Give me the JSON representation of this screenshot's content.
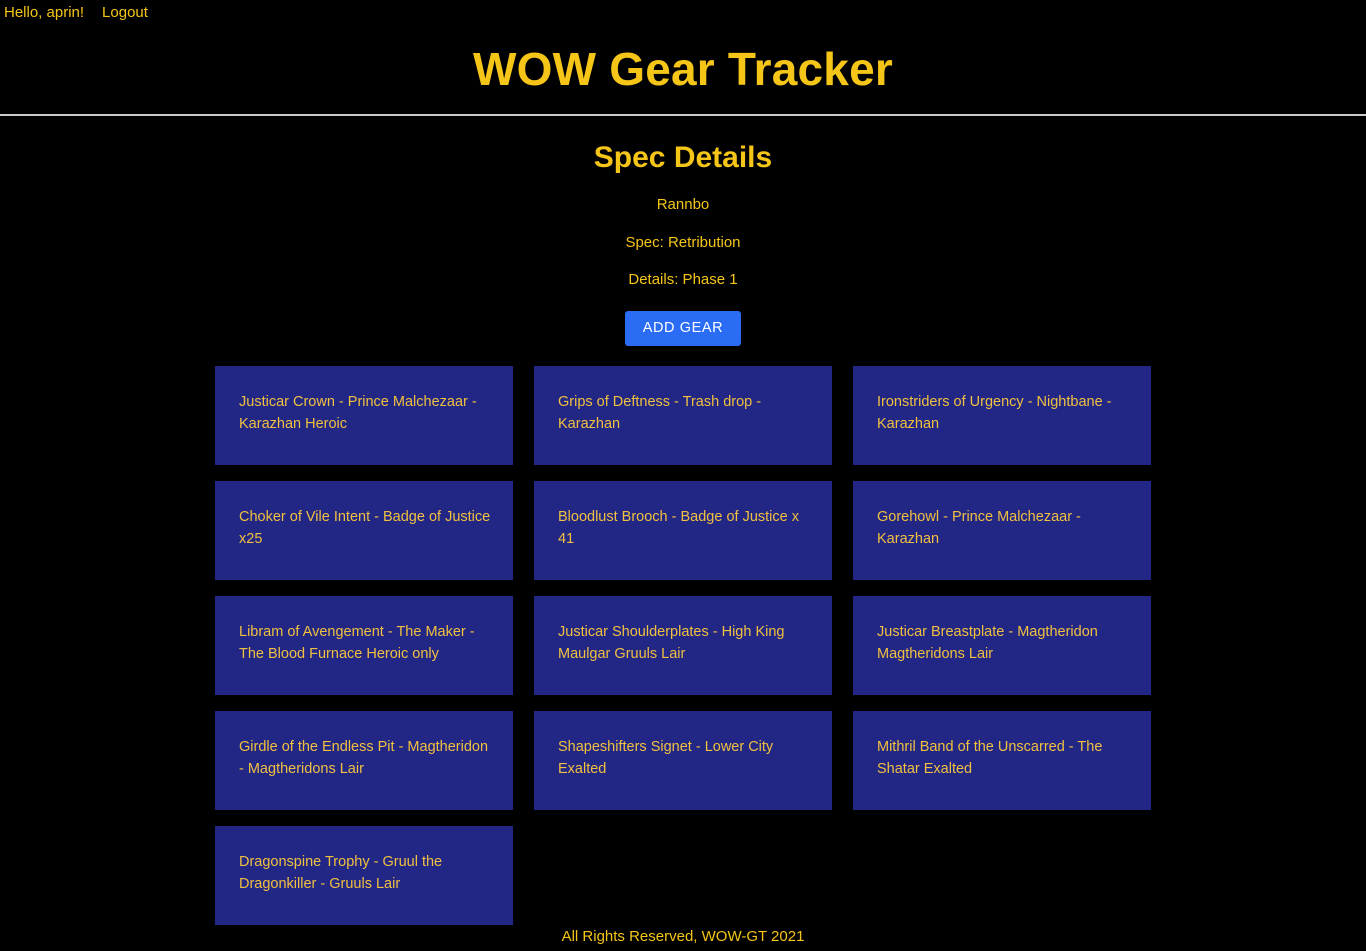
{
  "auth": {
    "greeting": "Hello, aprin!",
    "logout_label": "Logout"
  },
  "site": {
    "title": "WOW Gear Tracker"
  },
  "spec": {
    "heading": "Spec Details",
    "character": "Rannbo",
    "spec_line": "Spec: Retribution",
    "details_line": "Details: Phase 1",
    "add_gear_label": "ADD GEAR"
  },
  "colors": {
    "background": "#000000",
    "gold": "#f5c518",
    "card_navy": "#222685",
    "button_blue": "#2a6cf4",
    "divider": "#c9c9c9"
  },
  "gear": [
    {
      "label": "Justicar Crown - Prince Malchezaar - Karazhan Heroic"
    },
    {
      "label": "Grips of Deftness - Trash drop - Karazhan"
    },
    {
      "label": "Ironstriders of Urgency - Nightbane - Karazhan"
    },
    {
      "label": "Choker of Vile Intent - Badge of Justice x25"
    },
    {
      "label": "Bloodlust Brooch - Badge of Justice x 41"
    },
    {
      "label": "Gorehowl - Prince Malchezaar - Karazhan"
    },
    {
      "label": "Libram of Avengement - The Maker - The Blood Furnace Heroic only"
    },
    {
      "label": "Justicar Shoulderplates - High King Maulgar Gruuls Lair"
    },
    {
      "label": "Justicar Breastplate - Magtheridon Magtheridons Lair"
    },
    {
      "label": "Girdle of the Endless Pit - Magtheridon - Magtheridons Lair"
    },
    {
      "label": "Shapeshifters Signet - Lower City Exalted"
    },
    {
      "label": "Mithril Band of the Unscarred - The Shatar Exalted"
    },
    {
      "label": "Dragonspine Trophy - Gruul the Dragonkiller - Gruuls Lair"
    }
  ],
  "footer": {
    "text": "All Rights Reserved, WOW-GT 2021"
  }
}
